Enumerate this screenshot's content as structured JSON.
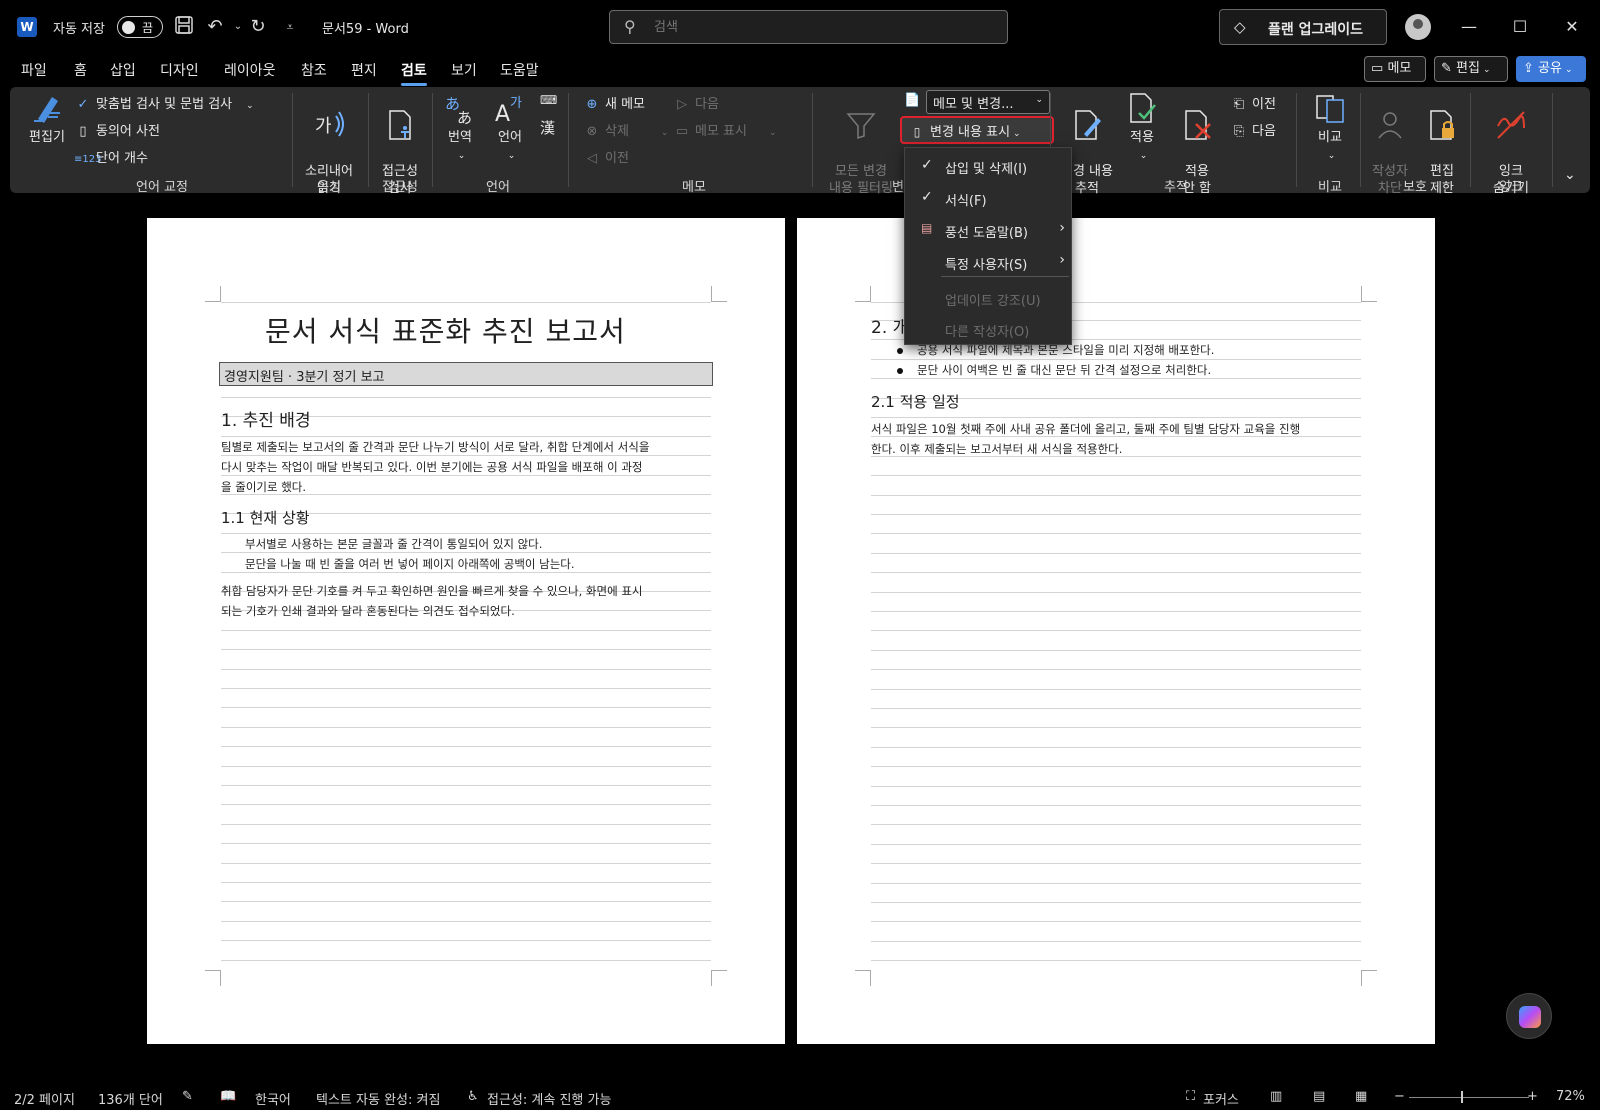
{
  "titlebar": {
    "app_icon": "W",
    "autosave_label": "자동 저장",
    "autosave_state": "끔",
    "doc_title": "문서59 - Word",
    "search_placeholder": "검색",
    "upgrade_label": "플랜 업그레이드",
    "icons": [
      "save-icon",
      "undo-icon",
      "redo-icon",
      "customize-qat-icon",
      "search-icon",
      "diamond-icon",
      "avatar-icon",
      "minimize-icon",
      "maximize-icon",
      "close-icon"
    ]
  },
  "menu": {
    "tabs": [
      "파일",
      "홈",
      "삽입",
      "디자인",
      "레이아웃",
      "참조",
      "편지",
      "검토",
      "보기",
      "도움말"
    ],
    "active_tab": "검토",
    "comment_btn": "메모",
    "edit_btn": "편집",
    "share_btn": "공유"
  },
  "ribbon": {
    "editor": "편집기",
    "spelling": "맞춤법 검사 및 문법 검사",
    "thesaurus": "동의어 사전",
    "wordcount": "단어 개수",
    "grp_proofing": "언어 교정",
    "readaloud": "소리내어\n읽기",
    "grp_speech": "음성",
    "accessibility": "접근성\n검사",
    "grp_accessibility": "접근성",
    "translate": "번역",
    "language": "언어",
    "grp_language": "언어",
    "new_comment": "새 메모",
    "delete": "삭제",
    "previous": "이전",
    "next": "다음",
    "show_comments": "메모 표시",
    "grp_comments": "메모",
    "filter_all": "모든 변경\n내용 필터링",
    "markup_combo": "메모 및 변경...",
    "show_markup": "변경 내용 표시",
    "grp_tracking_partial": "변",
    "track_changes": "변경 내용\n추적",
    "accept": "적용",
    "reject": "적용\n안 함",
    "prev_change": "이전",
    "next_change": "다음",
    "grp_tracking": "추적",
    "compare": "비교",
    "grp_compare": "비교",
    "block_authors": "작성자\n차단",
    "restrict_editing": "편집\n제한",
    "grp_protect": "보호",
    "hide_ink": "잉크\n숨기기",
    "grp_ink": "잉크"
  },
  "dropdown": {
    "items": [
      {
        "label": "삽입 및 삭제(I)",
        "checked": true,
        "submenu": false,
        "enabled": true
      },
      {
        "label": "서식(F)",
        "checked": true,
        "submenu": false,
        "enabled": true
      },
      {
        "label": "풍선 도움말(B)",
        "checked": false,
        "submenu": true,
        "enabled": true
      },
      {
        "label": "특정 사용자(S)",
        "checked": false,
        "submenu": true,
        "enabled": true
      },
      {
        "label": "업데이트 강조(U)",
        "checked": false,
        "submenu": false,
        "enabled": false
      },
      {
        "label": "다른 작성자(O)",
        "checked": false,
        "submenu": false,
        "enabled": false
      }
    ]
  },
  "page1": {
    "title": "문서 서식 표준화 추진 보고서",
    "subtitle": "경영지원팀 · 3분기 정기 보고",
    "h1": "1. 추진 배경",
    "p1_l1": "팀별로 제출되는 보고서의 줄 간격과 문단 나누기 방식이 서로 달라, 취합 단계에서 서식을",
    "p1_l2": "다시 맞추는 작업이 매달 반복되고 있다. 이번 분기에는 공용 서식 파일을 배포해 이 과정",
    "p1_l3": "을 줄이기로 했다.",
    "h2": "1.1 현재 상황",
    "l1": "부서별로 사용하는 본문 글꼴과 줄 간격이 통일되어 있지 않다.",
    "l2": "문단을 나눌 때 빈 줄을 여러 번 넣어 페이지 아래쪽에 공백이 남는다.",
    "p2_l1": "취합 담당자가 문단 기호를 켜 두고 확인하면 원인을 빠르게 찾을 수 있으나, 화면에 표시",
    "p2_l2": "되는 기호가 인쇄 결과와 달라 혼동된다는 의견도 접수되었다."
  },
  "page2": {
    "h1_partial": "2. 개",
    "b1": "공용 서식 파일에 제목과 본문 스타일을 미리 지정해 배포한다.",
    "b2": "문단 사이 여백은 빈 줄 대신 문단 뒤 간격 설정으로 처리한다.",
    "h2": "2.1 적용 일정",
    "p_l1": "서식 파일은 10월 첫째 주에 사내 공유 폴더에 올리고, 둘째 주에 팀별 담당자 교육을 진행",
    "p_l2": "한다. 이후 제출되는 보고서부터 새 서식을 적용한다."
  },
  "status": {
    "page": "2/2 페이지",
    "words": "136개 단어",
    "language": "한국어",
    "autocomplete": "텍스트 자동 완성: 켜짐",
    "accessibility": "접근성: 계속 진행 가능",
    "focus": "포커스",
    "zoom": "72%",
    "zoom_fraction": 0.43
  },
  "colors": {
    "accent": "#5aa0f0",
    "highlight_red": "#e0212e",
    "share_blue": "#3b78d8",
    "ribbon_bg": "#2c2c2c",
    "heading_gray_bg": "#d9d9d9"
  }
}
